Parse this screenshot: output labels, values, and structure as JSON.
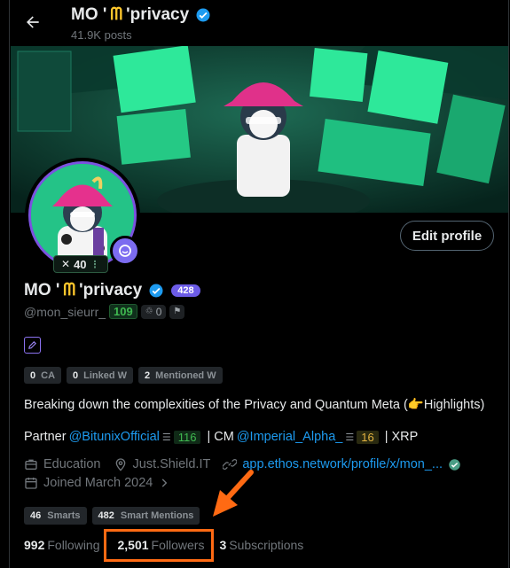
{
  "header": {
    "title": "MO '",
    "title_logo": "ᗰ",
    "title_suffix": "'privacy",
    "posts": "41.9K posts"
  },
  "avatar": {
    "count": "40"
  },
  "profile": {
    "edit_label": "Edit profile",
    "name": "MO '",
    "name_logo": "ᗰ",
    "name_suffix": "'privacy",
    "score": "428",
    "handle": "@mon_sieurr_",
    "handle_score": "109",
    "chip_count": "0"
  },
  "tags": [
    {
      "num": "0",
      "label": "CA"
    },
    {
      "num": "0",
      "label": "Linked W"
    },
    {
      "num": "2",
      "label": "Mentioned W"
    }
  ],
  "bio": {
    "line1": "Breaking down the complexities of the Privacy and Quantum Meta (👉Highlights)",
    "partner_prefix": "Partner",
    "partner_link": "@BitunixOfficial",
    "partner_num": "116",
    "cm_prefix": "| CM",
    "cm_link": "@Imperial_Alpha_",
    "cm_num": "16",
    "suffix": "| XRP"
  },
  "meta": {
    "category": "Education",
    "location": "Just.Shield.IT",
    "website": "app.ethos.network/profile/x/mon_...",
    "joined": "Joined March 2024"
  },
  "smarts": [
    {
      "num": "46",
      "label": "Smarts"
    },
    {
      "num": "482",
      "label": "Smart Mentions"
    }
  ],
  "follow": {
    "following_count": "992",
    "following_label": "Following",
    "followers_count": "2,501",
    "followers_label": "Followers",
    "subs_count": "3",
    "subs_label": "Subscriptions"
  },
  "colors": {
    "accent": "#1d9bf0",
    "verified": "#1d9bf0",
    "annotation": "#ff6a13",
    "score_badge": "#6c5ce7"
  }
}
